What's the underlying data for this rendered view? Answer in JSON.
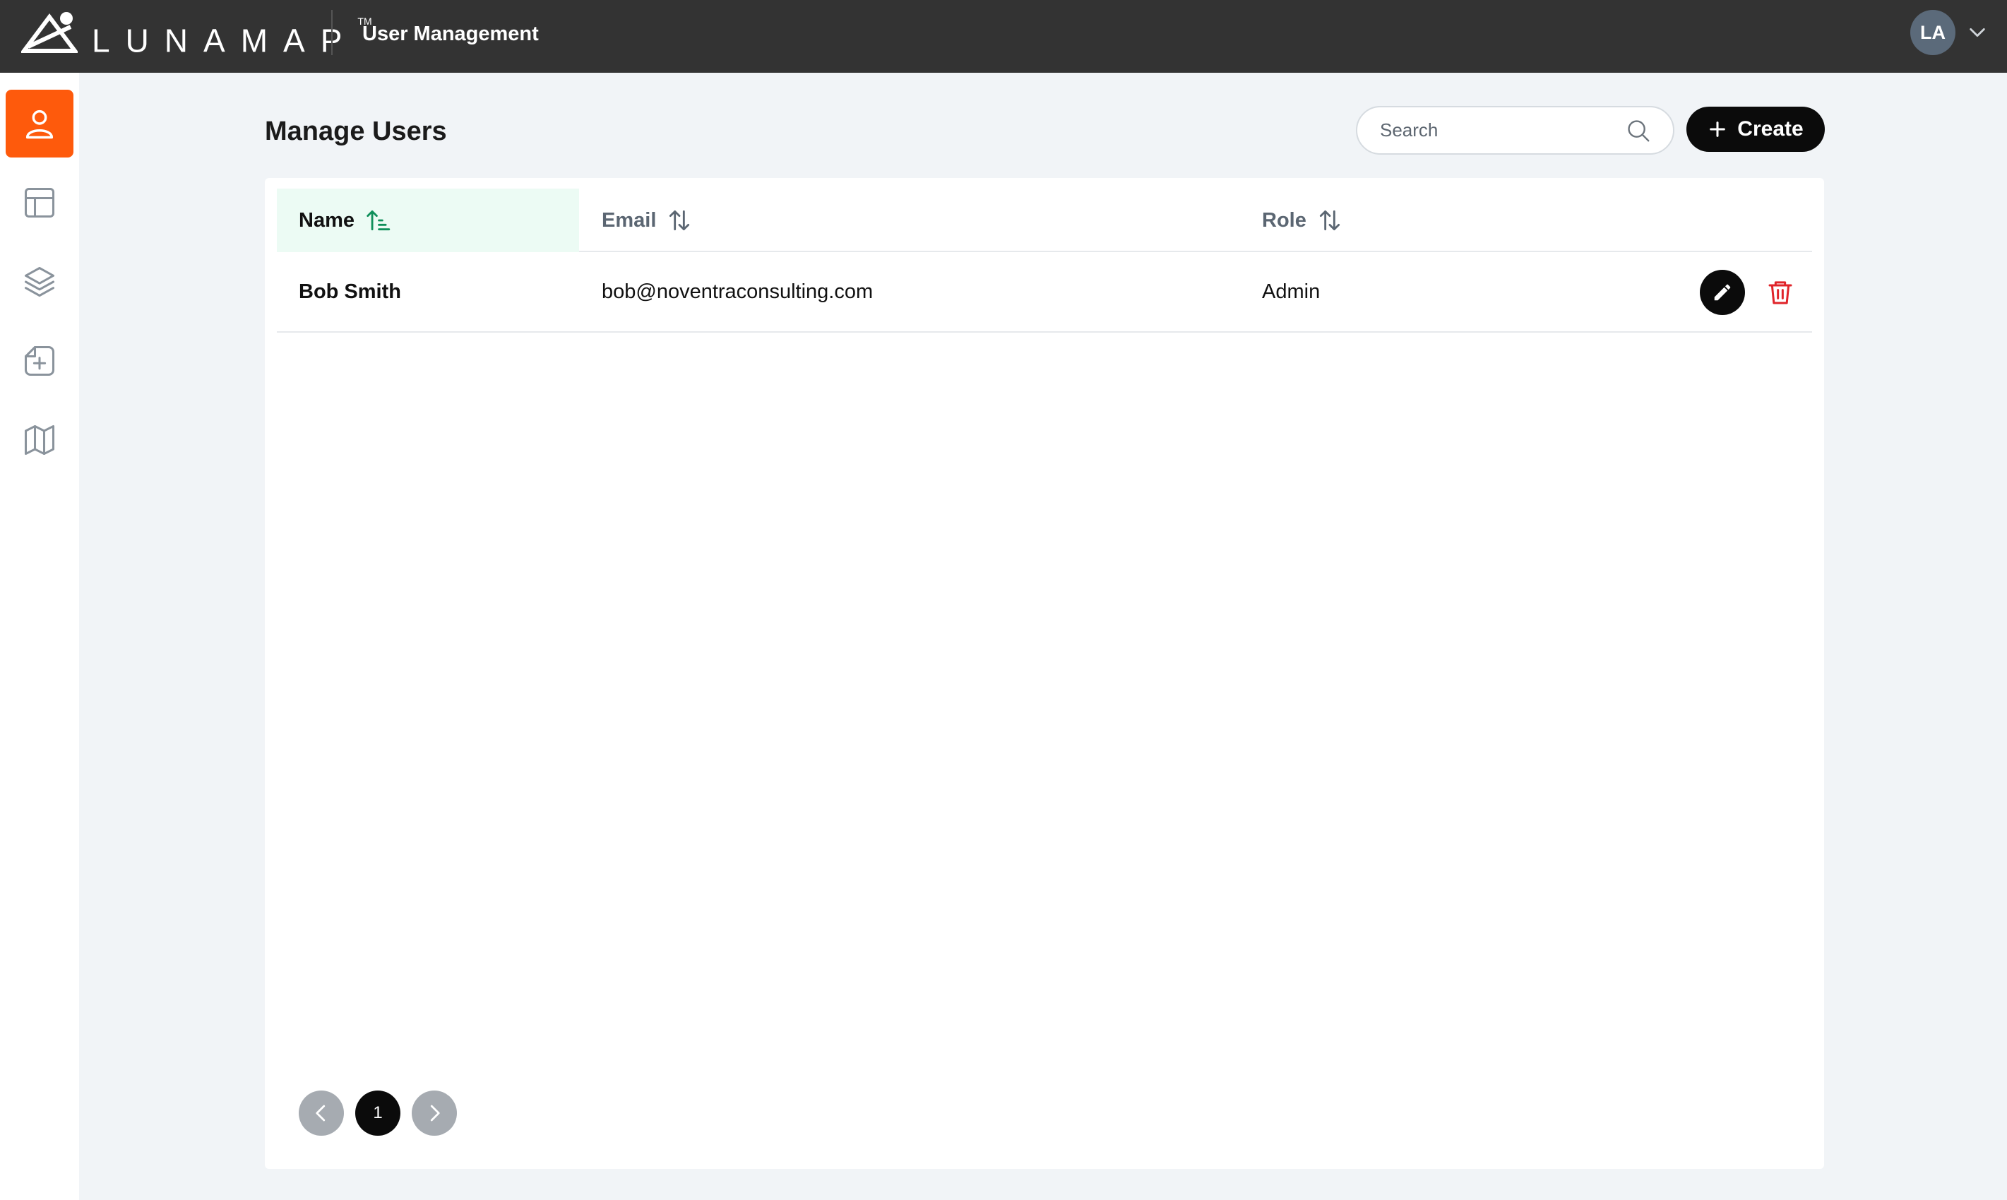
{
  "header": {
    "brand": "LUNAMAP",
    "trademark": "TM",
    "app_title": "User Management",
    "user_initials": "LA"
  },
  "sidebar": {
    "items": [
      {
        "icon": "user-icon",
        "active": true
      },
      {
        "icon": "layout-icon",
        "active": false
      },
      {
        "icon": "layers-icon",
        "active": false
      },
      {
        "icon": "add-file-icon",
        "active": false
      },
      {
        "icon": "map-icon",
        "active": false
      }
    ]
  },
  "main": {
    "title": "Manage Users",
    "search_placeholder": "Search",
    "create_label": "Create"
  },
  "table": {
    "columns": [
      {
        "label": "Name",
        "sort": "ascending"
      },
      {
        "label": "Email",
        "sort": "none"
      },
      {
        "label": "Role",
        "sort": "none"
      }
    ],
    "rows": [
      {
        "name": "Bob Smith",
        "email": "bob@noventraconsulting.com",
        "role": "Admin"
      }
    ]
  },
  "pagination": {
    "current_page": "1"
  },
  "colors": {
    "accent": "#fe5a0c",
    "topbar": "#333333",
    "sorted_header_bg": "#ecfbf4",
    "delete": "#e0242a"
  }
}
